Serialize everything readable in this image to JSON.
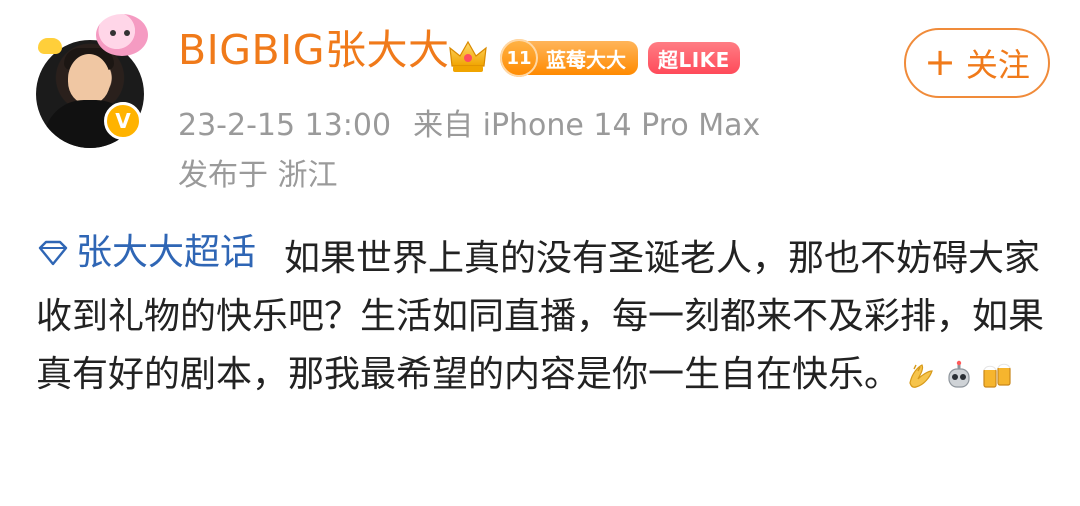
{
  "author": {
    "name": "BIGBIG张大大",
    "level": "11",
    "level_title": "蓝莓大大",
    "super_like": "超LIKE"
  },
  "follow_button": {
    "plus": "+",
    "label": "关注"
  },
  "meta": {
    "time": "23-2-15 13:00",
    "source": "来自 iPhone 14 Pro Max",
    "location": "发布于 浙江"
  },
  "post": {
    "topic": "张大大超话",
    "text": "如果世界上真的没有圣诞老人，那也不妨碍大家收到礼物的快乐吧？生活如同直播，每一刻都来不及彩排，如果真有好的剧本，那我最希望的内容是你一生自在快乐。"
  },
  "icons": {
    "verified": "v-icon",
    "topic": "diamond-icon",
    "crown": "crown-icon",
    "emojis": [
      "clap-hands-icon",
      "robot-icon",
      "cheers-icon"
    ]
  },
  "colors": {
    "username": "#f07a1a",
    "topic": "#2f66b5",
    "meta": "#9a9a9a",
    "follow_border": "#f08b3a",
    "level_badge": "#ff8a00",
    "super_like_badge": "#ff4a5a"
  }
}
